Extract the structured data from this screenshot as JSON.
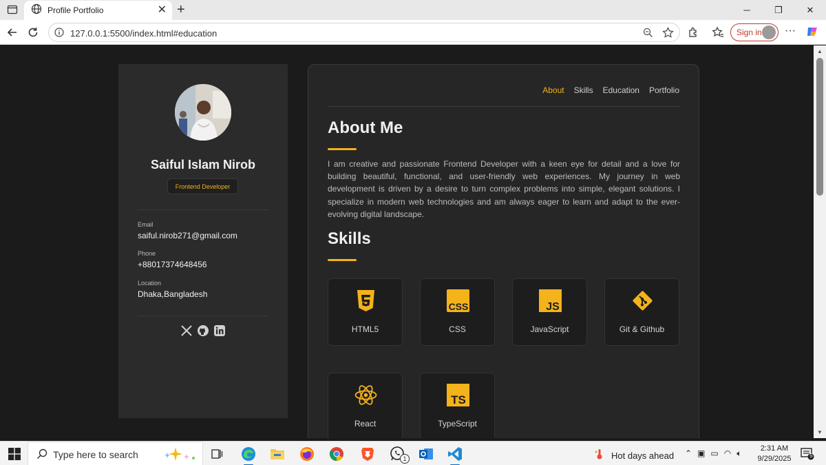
{
  "browser": {
    "tab_title": "Profile Portfolio",
    "url": "127.0.0.1:5500/index.html#education",
    "signin_label": "Sign in"
  },
  "profile": {
    "name": "Saiful Islam Nirob",
    "role": "Frontend Developer",
    "contacts": [
      {
        "label": "Email",
        "value": "saiful.nirob271@gmail.com"
      },
      {
        "label": "Phone",
        "value": "+88017374648456"
      },
      {
        "label": "Location",
        "value": "Dhaka,Bangladesh"
      }
    ],
    "social": [
      "x-icon",
      "github-icon",
      "linkedin-icon"
    ]
  },
  "nav": {
    "items": [
      "About",
      "Skills",
      "Education",
      "Portfolio"
    ],
    "active": "About"
  },
  "about": {
    "title": "About Me",
    "text": "I am creative and passionate Frontend Developer with a keen eye for detail and a love for building beautiful, functional, and user-friendly web experiences. My journey in web development is driven by a desire to turn complex problems into simple, elegant solutions. I specialize in modern web technologies and am always eager to learn and adapt to the ever-evolving digital landscape."
  },
  "skills": {
    "title": "Skills",
    "items": [
      {
        "label": "HTML5",
        "icon": "html5-icon"
      },
      {
        "label": "CSS",
        "icon": "css-icon"
      },
      {
        "label": "JavaScript",
        "icon": "javascript-icon"
      },
      {
        "label": "Git & Github",
        "icon": "git-icon"
      },
      {
        "label": "React",
        "icon": "react-icon"
      },
      {
        "label": "TypeScript",
        "icon": "typescript-icon"
      }
    ]
  },
  "theme": {
    "accent": "#f4b21b",
    "background": "#1b1b1b",
    "card": "#262626"
  },
  "taskbar": {
    "search_placeholder": "Type here to search",
    "weather": "Hot days ahead",
    "time": "2:31 AM",
    "date": "9/29/2025",
    "whatsapp_badge": "1",
    "notification_count": "5"
  }
}
